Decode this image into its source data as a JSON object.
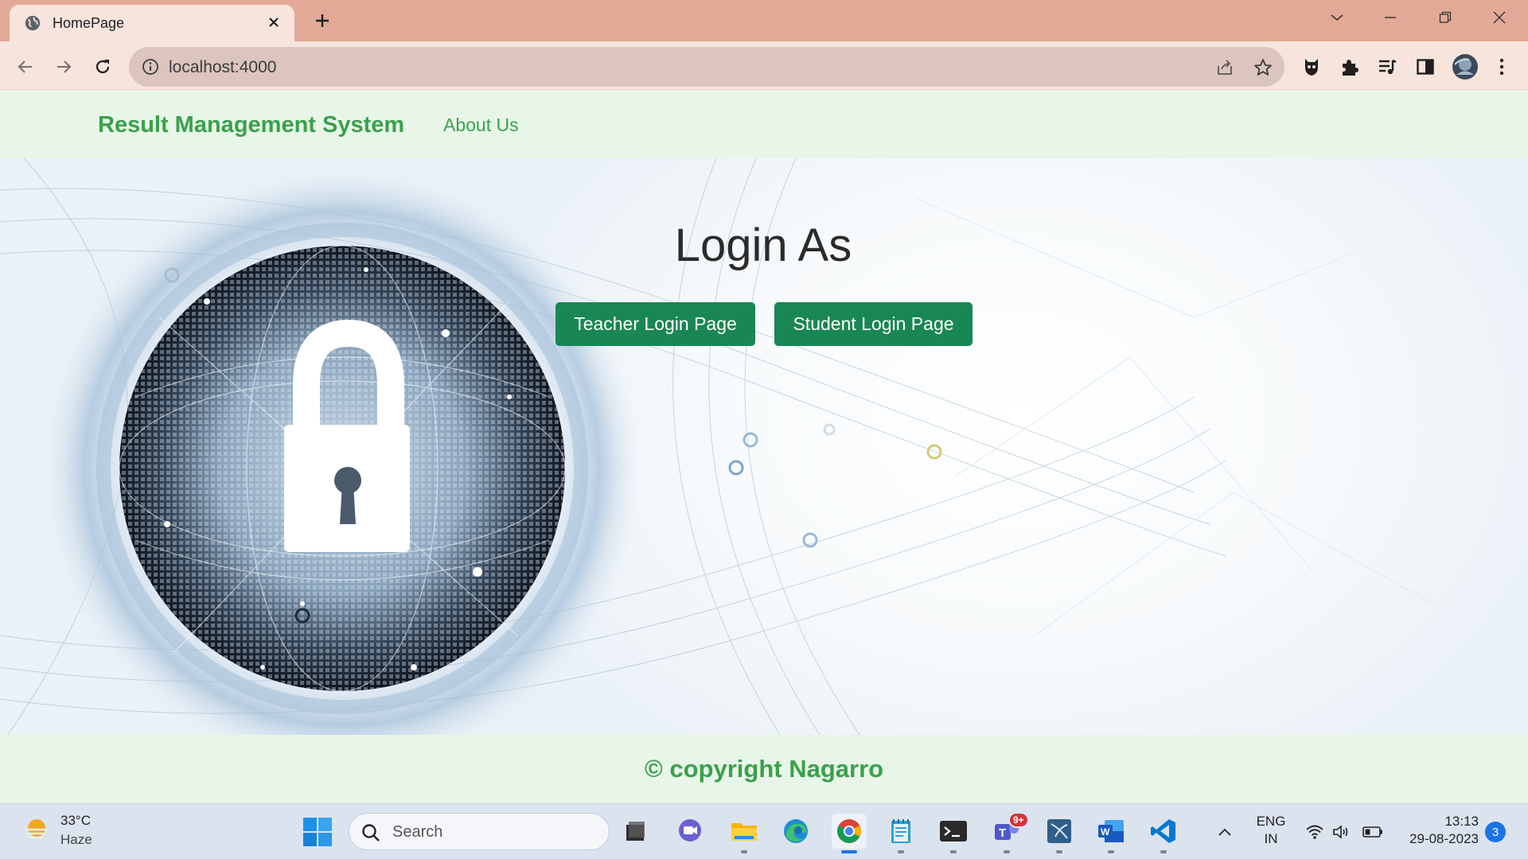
{
  "browser": {
    "tab_title": "HomePage",
    "url": "localhost:4000",
    "colors": {
      "frame": "#e3a997",
      "toolbar": "#f6e4dd",
      "omnibox": "#dcc5be"
    },
    "icons": [
      "globe-icon",
      "close-icon",
      "plus-icon",
      "chevron-down-icon",
      "minimize-icon",
      "restore-icon",
      "window-close-icon",
      "back-arrow-icon",
      "forward-arrow-icon",
      "reload-icon",
      "info-icon",
      "share-icon",
      "star-icon",
      "extension-shield-icon",
      "puzzle-icon",
      "media-queue-icon",
      "side-panel-icon",
      "profile-avatar",
      "menu-kebab-icon"
    ]
  },
  "page": {
    "brand": "Result Management System",
    "nav_about": "About Us",
    "heading": "Login As",
    "teacher_button": "Teacher Login Page",
    "student_button": "Student Login Page",
    "footer": "© copyright Nagarro",
    "colors": {
      "brand_green": "#3aa14a",
      "button_green": "#198754",
      "nav_bg": "#e8f5e9"
    }
  },
  "taskbar": {
    "weather_temp": "33°C",
    "weather_condition": "Haze",
    "search_placeholder": "Search",
    "teams_badge": "9+",
    "lang_line1": "ENG",
    "lang_line2": "IN",
    "time": "13:13",
    "date": "29-08-2023",
    "notification_count": "3",
    "apps": [
      "file-explorer-dark-icon",
      "teams-chat-icon",
      "file-explorer-icon",
      "edge-icon",
      "chrome-icon",
      "notepad-icon",
      "terminal-icon",
      "teams-icon",
      "mysql-workbench-icon",
      "word-icon",
      "vscode-icon"
    ]
  }
}
